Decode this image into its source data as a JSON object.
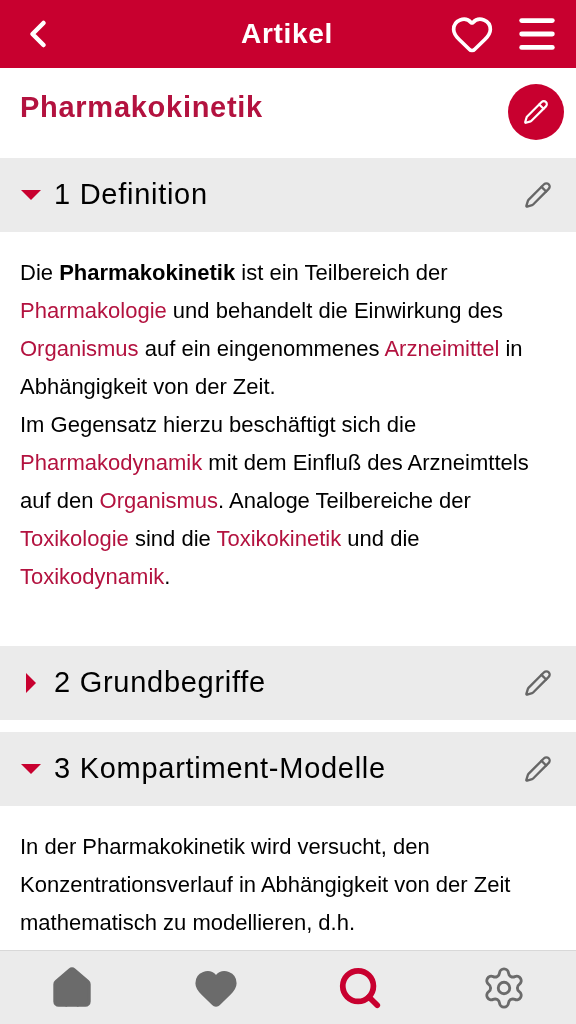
{
  "header": {
    "title": "Artikel"
  },
  "article": {
    "title": "Pharmakokinetik"
  },
  "sections": [
    {
      "number": "1",
      "title": "Definition",
      "expanded": true,
      "paragraphs": [
        [
          {
            "kind": "plain",
            "text": "Die "
          },
          {
            "kind": "bold",
            "text": "Pharmakokinetik"
          },
          {
            "kind": "plain",
            "text": " ist ein Teilbereich der "
          },
          {
            "kind": "link",
            "text": "Pharmakologie"
          },
          {
            "kind": "plain",
            "text": " und behandelt die Einwirkung des "
          },
          {
            "kind": "link",
            "text": "Organismus"
          },
          {
            "kind": "plain",
            "text": " auf ein eingenommenes "
          },
          {
            "kind": "link",
            "text": "Arzneimittel"
          },
          {
            "kind": "plain",
            "text": " in Abhängigkeit von der Zeit."
          }
        ],
        [
          {
            "kind": "plain",
            "text": "Im Gegensatz hierzu beschäftigt sich die "
          },
          {
            "kind": "link",
            "text": "Pharmakodynamik"
          },
          {
            "kind": "plain",
            "text": " mit dem Einfluß des Arzneimttels auf den "
          },
          {
            "kind": "link",
            "text": "Organismus"
          },
          {
            "kind": "plain",
            "text": ". Analoge Teilbereiche der "
          },
          {
            "kind": "link",
            "text": "Toxikologie"
          },
          {
            "kind": "plain",
            "text": " sind die "
          },
          {
            "kind": "link",
            "text": "Toxikokinetik"
          },
          {
            "kind": "plain",
            "text": " und die "
          },
          {
            "kind": "link",
            "text": "Toxikodynamik"
          },
          {
            "kind": "plain",
            "text": "."
          }
        ]
      ]
    },
    {
      "number": "2",
      "title": "Grundbegriffe",
      "expanded": false
    },
    {
      "number": "3",
      "title": "Kompartiment-Modelle",
      "expanded": true,
      "paragraphs": [
        [
          {
            "kind": "plain",
            "text": "In der Pharmakokinetik wird versucht, den Konzentrationsverlauf in Abhängigkeit von der Zeit mathematisch zu modellieren, d.h."
          }
        ]
      ]
    }
  ],
  "bottom_nav": [
    {
      "kind": "home",
      "selected": false
    },
    {
      "kind": "favorites",
      "selected": false
    },
    {
      "kind": "search",
      "selected": true
    },
    {
      "kind": "settings",
      "selected": false
    }
  ]
}
